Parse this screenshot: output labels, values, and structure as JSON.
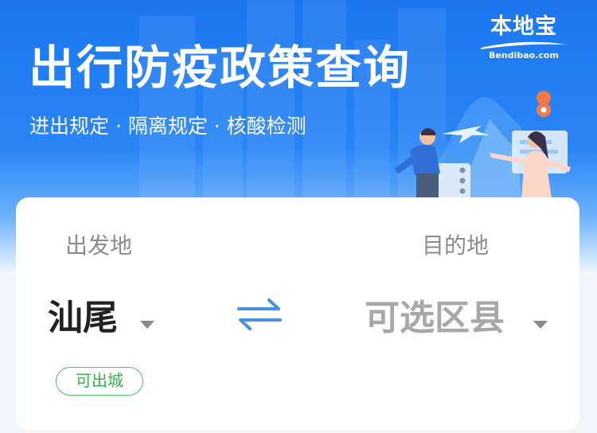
{
  "banner": {
    "title": "出行防疫政策查询",
    "subtitle": "进出规定 · 隔离规定 · 核酸检测",
    "logo_cn": "本地宝",
    "logo_en": "Bendibao.com"
  },
  "query": {
    "from_label": "出发地",
    "to_label": "目的地",
    "from_city": "汕尾",
    "to_city": "可选区县",
    "swap_icon": "swap-arrows-icon",
    "status_badge": "可出城"
  },
  "colors": {
    "banner_blue": "#1b76f0",
    "swap_blue": "#4a8fe6",
    "badge_green": "#3aaf54"
  }
}
